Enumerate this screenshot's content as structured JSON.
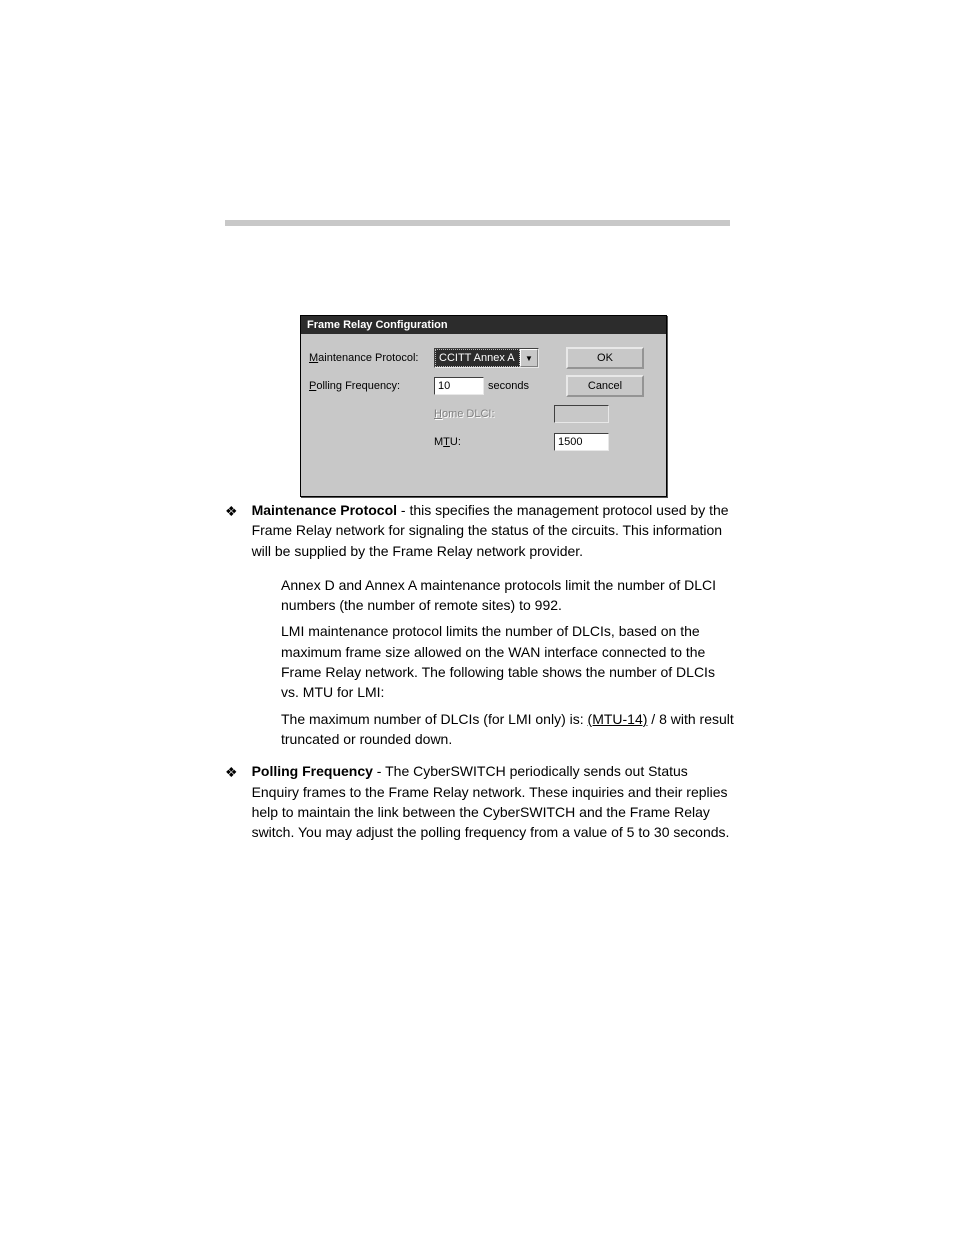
{
  "dialog": {
    "title": "Frame Relay Configuration",
    "maintenance_label_pre": "M",
    "maintenance_label_rest": "aintenance Protocol:",
    "maintenance_value": "CCITT Annex A",
    "poll_label_pre": "P",
    "poll_label_rest": "olling Frequency:",
    "poll_value": "10",
    "poll_unit": "seconds",
    "home_label_pre": "H",
    "home_label_rest": "ome DLCI:",
    "home_value": "",
    "mtu_label_pre1": "M",
    "mtu_label_ul": "T",
    "mtu_label_post": "U:",
    "mtu_value": "1500",
    "ok_label": "OK",
    "cancel_label": "Cancel",
    "dropdown_glyph": "▼"
  },
  "text": {
    "bullet_glyph": "❖",
    "mp_head": "Maintenance Protocol",
    "mp_tail": " - this specifies the management protocol used by the Frame Relay network for signaling the status of the circuits. This information will be supplied by the Frame Relay network provider.",
    "mp_p2": "Annex D and Annex A maintenance protocols limit the number of DLCI numbers (the number of remote sites) to 992.",
    "mp_p3": "LMI maintenance protocol limits the number of DLCIs, based on the maximum frame size allowed on the WAN interface connected to the Frame Relay network. The following table shows the number of DLCIs vs. MTU for LMI:",
    "mp_p4_a": "The maximum number of DLCIs (for LMI only) is: ",
    "mp_p4_b": "(MTU-14)",
    "mp_p4_c": " / 8 with result truncated or rounded down.",
    "pf_head": "Polling Frequency",
    "pf_tail": " - The CyberSWITCH periodically sends out Status Enquiry frames to the Frame Relay network. These inquiries and their replies help to maintain the link between the CyberSWITCH and the Frame Relay switch. You may adjust the polling frequency from a value of 5 to 30 seconds."
  }
}
